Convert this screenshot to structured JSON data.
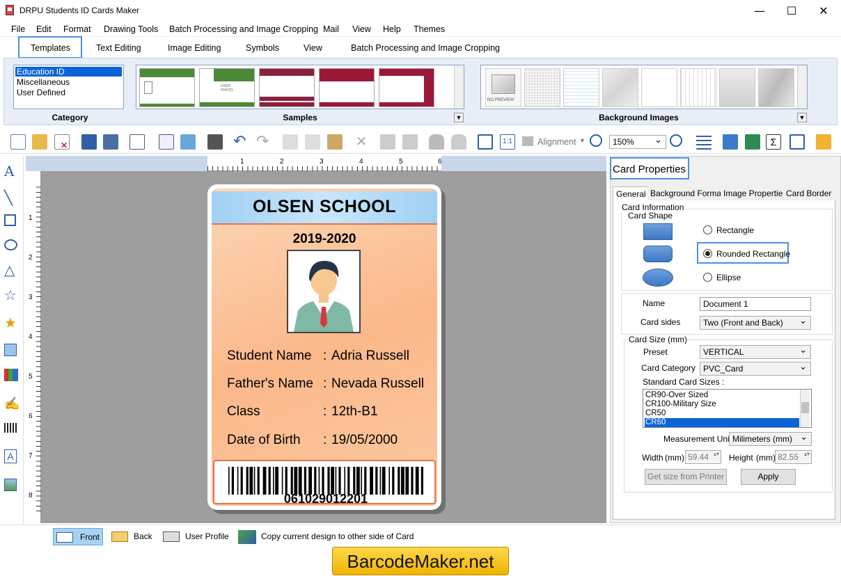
{
  "window": {
    "title": "DRPU Students ID Cards Maker",
    "minimize": "—",
    "maximize": "☐",
    "close": "✕"
  },
  "menu": [
    "File",
    "Edit",
    "Format",
    "Drawing Tools",
    "Batch Processing and Image Cropping",
    "Mail",
    "View",
    "Help",
    "Themes"
  ],
  "ribbon_tabs": [
    "Templates",
    "Text Editing",
    "Image Editing",
    "Symbols",
    "View",
    "Batch Processing and Image Cropping"
  ],
  "ribbon": {
    "category_title": "Category",
    "categories": [
      "Education ID",
      "Miscellaneous",
      "User Defined"
    ],
    "samples_title": "Samples",
    "background_title": "Background Images",
    "no_preview": "NO PREVIEW",
    "user_photo": "USER PHOTO"
  },
  "toolbar": {
    "alignment": "Alignment",
    "zoom": "150%"
  },
  "ruler": {
    "top": [
      "1",
      "2",
      "3",
      "4",
      "5",
      "6"
    ],
    "left": [
      "1",
      "2",
      "3",
      "4",
      "5",
      "6",
      "7",
      "8"
    ]
  },
  "card": {
    "school": "OLSEN SCHOOL",
    "year": "2019-2020",
    "fields": [
      {
        "label": "Student Name",
        "value": "Adria Russell"
      },
      {
        "label": "Father's Name",
        "value": "Nevada Russell"
      },
      {
        "label": "Class",
        "value": "12th-B1"
      },
      {
        "label": "Date of Birth",
        "value": "19/05/2000"
      }
    ],
    "colon": ":",
    "barcode_number": "061029012201"
  },
  "panel": {
    "title": "Card Properties",
    "tabs": [
      "General",
      "Background Format",
      "Image Properties",
      "Card Border"
    ],
    "card_information": "Card Information",
    "card_shape": "Card Shape",
    "shapes": [
      {
        "label": "Rectangle",
        "selected": false
      },
      {
        "label": "Rounded Rectangle",
        "selected": true
      },
      {
        "label": "Ellipse",
        "selected": false
      }
    ],
    "name_label": "Name",
    "name_value": "Document 1",
    "card_sides_label": "Card sides",
    "card_sides_value": "Two (Front and Back)",
    "card_size_title": "Card Size (mm)",
    "preset_label": "Preset",
    "preset_value": "VERTICAL",
    "card_category_label": "Card Category",
    "card_category_value": "PVC_Card",
    "standard_sizes_label": "Standard Card Sizes :",
    "standard_sizes": [
      "CR90-Over Sized",
      "CR100-Military Size",
      "CR50",
      "CR60"
    ],
    "selected_size": "CR60",
    "measurement_label": "Measurement Unit :",
    "measurement_value": "Milimeters (mm)",
    "width_label": "Width",
    "width_unit": "(mm)",
    "width_value": "59.44",
    "height_label": "Height",
    "height_unit": "(mm)",
    "height_value": "82.55",
    "get_size_button": "Get size from Printer",
    "apply_button": "Apply"
  },
  "bottom": {
    "front": "Front",
    "back": "Back",
    "user_profile": "User Profile",
    "copy": "Copy current design to other side of Card"
  },
  "footer": {
    "logo": "BarcodeMaker.net"
  },
  "colors": {
    "accent": "#4a90e2",
    "selection": "#0a64d8",
    "card_band": "#9fd0f3",
    "card_border": "#e2744a"
  }
}
